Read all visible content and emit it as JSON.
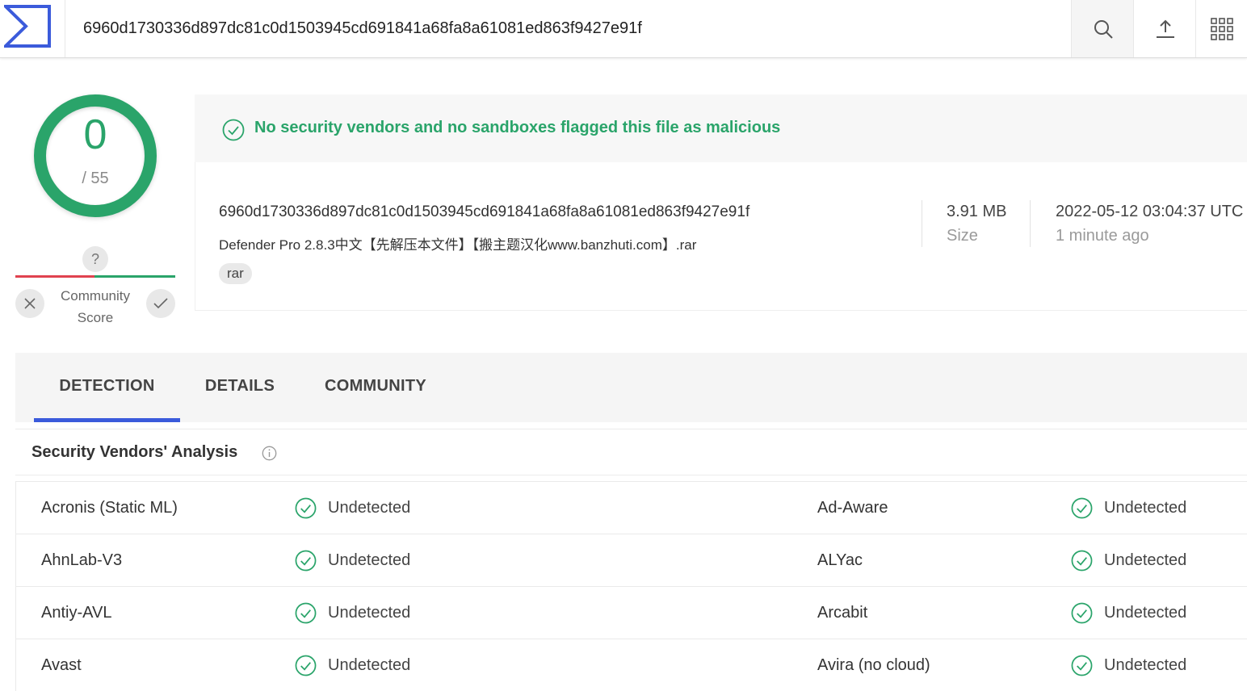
{
  "search": {
    "value": "6960d1730336d897dc81c0d1503945cd691841a68fa8a61081ed863f9427e91f"
  },
  "score": {
    "detections": "0",
    "total": "/ 55"
  },
  "community": {
    "question": "?",
    "label": "Community Score"
  },
  "banner": {
    "message": "No security vendors and no sandboxes flagged this file as malicious"
  },
  "file": {
    "hash": "6960d1730336d897dc81c0d1503945cd691841a68fa8a61081ed863f9427e91f",
    "name": "Defender Pro 2.8.3中文【先解压本文件】【搬主题汉化www.banzhuti.com】.rar",
    "tag": "rar",
    "size_value": "3.91 MB",
    "size_label": "Size",
    "date_value": "2022-05-12 03:04:37 UTC",
    "date_label": "1 minute ago"
  },
  "tabs": [
    {
      "label": "DETECTION",
      "active": true
    },
    {
      "label": "DETAILS",
      "active": false
    },
    {
      "label": "COMMUNITY",
      "active": false
    }
  ],
  "section": {
    "title": "Security Vendors' Analysis"
  },
  "vendors": [
    {
      "left": "Acronis (Static ML)",
      "left_status": "Undetected",
      "right": "Ad-Aware",
      "right_status": "Undetected"
    },
    {
      "left": "AhnLab-V3",
      "left_status": "Undetected",
      "right": "ALYac",
      "right_status": "Undetected"
    },
    {
      "left": "Antiy-AVL",
      "left_status": "Undetected",
      "right": "Arcabit",
      "right_status": "Undetected"
    },
    {
      "left": "Avast",
      "left_status": "Undetected",
      "right": "Avira (no cloud)",
      "right_status": "Undetected"
    }
  ],
  "colors": {
    "accent": "#3b5bdb",
    "clean": "#2aa46a",
    "malicious": "#e0424f"
  },
  "icons": [
    "logo-icon",
    "search-icon",
    "upload-icon",
    "apps-grid-icon",
    "check-circle-icon",
    "close-icon",
    "check-icon",
    "info-icon"
  ]
}
